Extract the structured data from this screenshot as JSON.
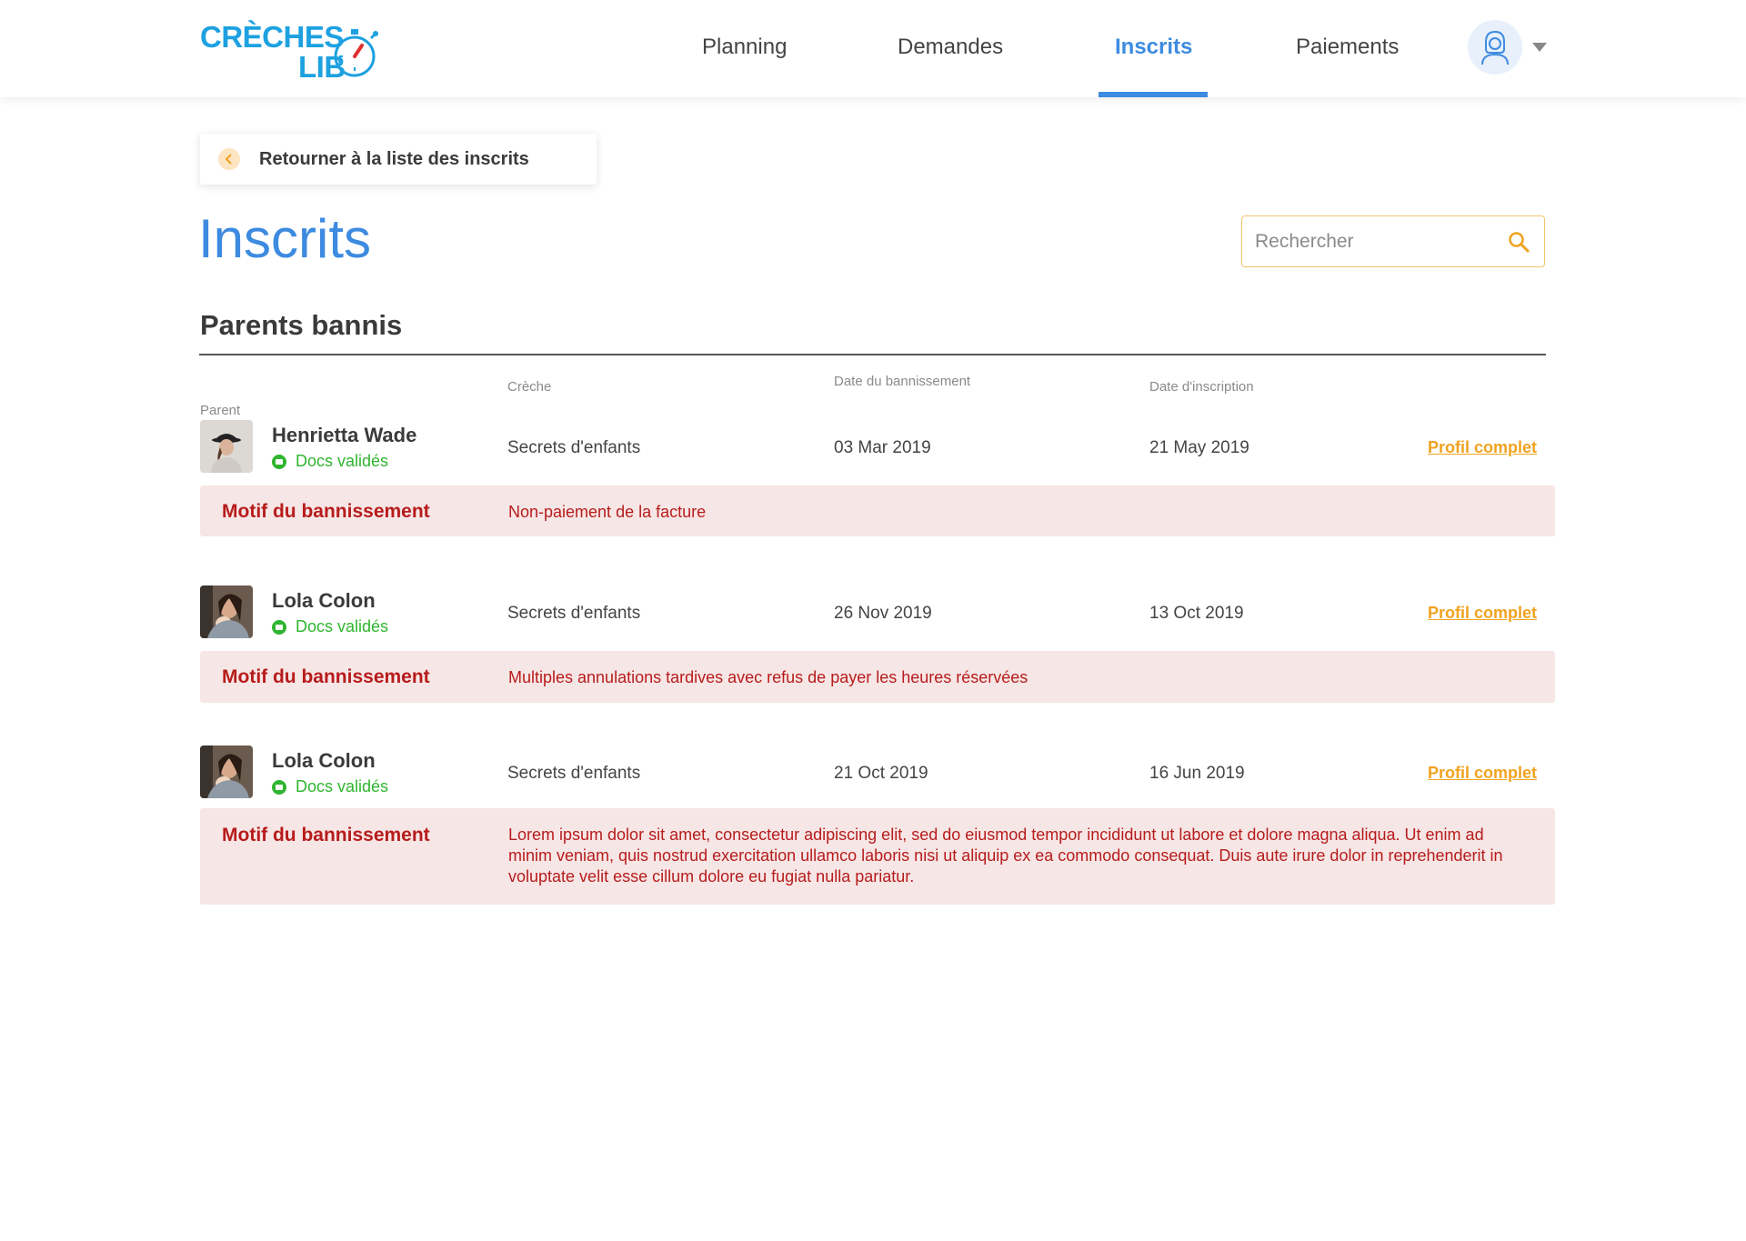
{
  "logo": {
    "line1": "CRÈCHES",
    "line2": "LIB"
  },
  "nav": {
    "items": [
      {
        "label": "Planning"
      },
      {
        "label": "Demandes"
      },
      {
        "label": "Inscrits"
      },
      {
        "label": "Paiements"
      }
    ],
    "active": "Inscrits"
  },
  "back_button": {
    "label": "Retourner à la liste des inscrits"
  },
  "page_title": "Inscrits",
  "search": {
    "placeholder": "Rechercher",
    "value": ""
  },
  "section": {
    "title": "Parents bannis"
  },
  "columns": {
    "parent": "Parent",
    "creche": "Crèche",
    "ban_date": "Date du bannissement",
    "signup_date": "Date d'inscription"
  },
  "rows": [
    {
      "name": "Henrietta Wade",
      "docs": "Docs validés",
      "creche": "Secrets d'enfants",
      "ban_date": "03 Mar 2019",
      "signup_date": "21 May 2019",
      "profile_link": "Profil complet",
      "ban_label": "Motif du bannissement",
      "ban_reason": "Non-paiement de la facture"
    },
    {
      "name": "Lola Colon",
      "docs": "Docs validés",
      "creche": "Secrets d'enfants",
      "ban_date": "26 Nov 2019",
      "signup_date": "13 Oct 2019",
      "profile_link": "Profil complet",
      "ban_label": "Motif du bannissement",
      "ban_reason": "Multiples annulations tardives avec refus de payer les heures réservées"
    },
    {
      "name": "Lola Colon",
      "docs": "Docs validés",
      "creche": "Secrets d'enfants",
      "ban_date": "21 Oct 2019",
      "signup_date": "16 Jun 2019",
      "profile_link": "Profil complet",
      "ban_label": "Motif du bannissement",
      "ban_reason": "Lorem ipsum dolor sit amet, consectetur adipiscing elit, sed do eiusmod tempor incididunt ut labore et dolore magna aliqua. Ut enim ad minim veniam, quis nostrud exercitation ullamco laboris nisi ut aliquip ex ea commodo consequat. Duis aute irure dolor in reprehenderit in voluptate velit esse cillum dolore eu fugiat nulla pariatur."
    }
  ],
  "colors": {
    "brand_blue": "#1da1e0",
    "accent_blue": "#3d8be0",
    "link_orange": "#f0a320",
    "ban_red": "#b71c1c",
    "ban_bg": "#f7e6e6",
    "success_green": "#2fb52f"
  }
}
